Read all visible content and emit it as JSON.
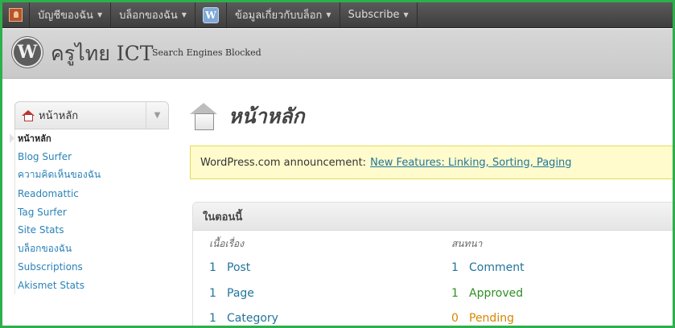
{
  "admin_bar": {
    "items": [
      {
        "label": "บัญชีของฉัน"
      },
      {
        "label": "บล็อกของฉัน"
      },
      {
        "label": "ข้อมูลเกี่ยวกับบล็อก"
      },
      {
        "label": "Subscribe"
      }
    ],
    "wp_glyph": "W"
  },
  "header": {
    "site_title": "ครูไทย ICT",
    "subtitle": "Search Engines Blocked",
    "logo_glyph": "W"
  },
  "sidebar": {
    "menu_title": "หน้าหลัก",
    "toggle_glyph": "▼",
    "items": [
      {
        "label": "หน้าหลัก",
        "current": true
      },
      {
        "label": "Blog Surfer"
      },
      {
        "label": "ความคิดเห็นของฉัน"
      },
      {
        "label": "Readomattic"
      },
      {
        "label": "Tag Surfer"
      },
      {
        "label": "Site Stats"
      },
      {
        "label": "บล็อกของฉัน"
      },
      {
        "label": "Subscriptions"
      },
      {
        "label": "Akismet Stats"
      }
    ]
  },
  "main": {
    "page_title": "หน้าหลัก",
    "notice": {
      "text": "WordPress.com announcement:",
      "link": "New Features: Linking, Sorting, Paging"
    },
    "right_now": {
      "title": "ในตอนนี้",
      "content_heading": "เนื้อเรื่อง",
      "discussion_heading": "สนทนา",
      "content": [
        {
          "num": "1",
          "label": "Post"
        },
        {
          "num": "1",
          "label": "Page"
        },
        {
          "num": "1",
          "label": "Category"
        }
      ],
      "discussion": [
        {
          "num": "1",
          "label": "Comment",
          "status": "normal"
        },
        {
          "num": "1",
          "label": "Approved",
          "status": "approved"
        },
        {
          "num": "0",
          "label": "Pending",
          "status": "pending"
        }
      ]
    }
  },
  "colors": {
    "frame": "#2db04b",
    "link": "#21759b",
    "approved": "#2f8f24",
    "pending": "#d98500",
    "notice_bg": "#fffbcc"
  },
  "icons": {
    "account_avatar": "user-avatar-icon",
    "wordpress": "wordpress-logo-icon",
    "home": "home-icon",
    "dashboard_house": "house-icon",
    "caret": "chevron-down-icon"
  }
}
